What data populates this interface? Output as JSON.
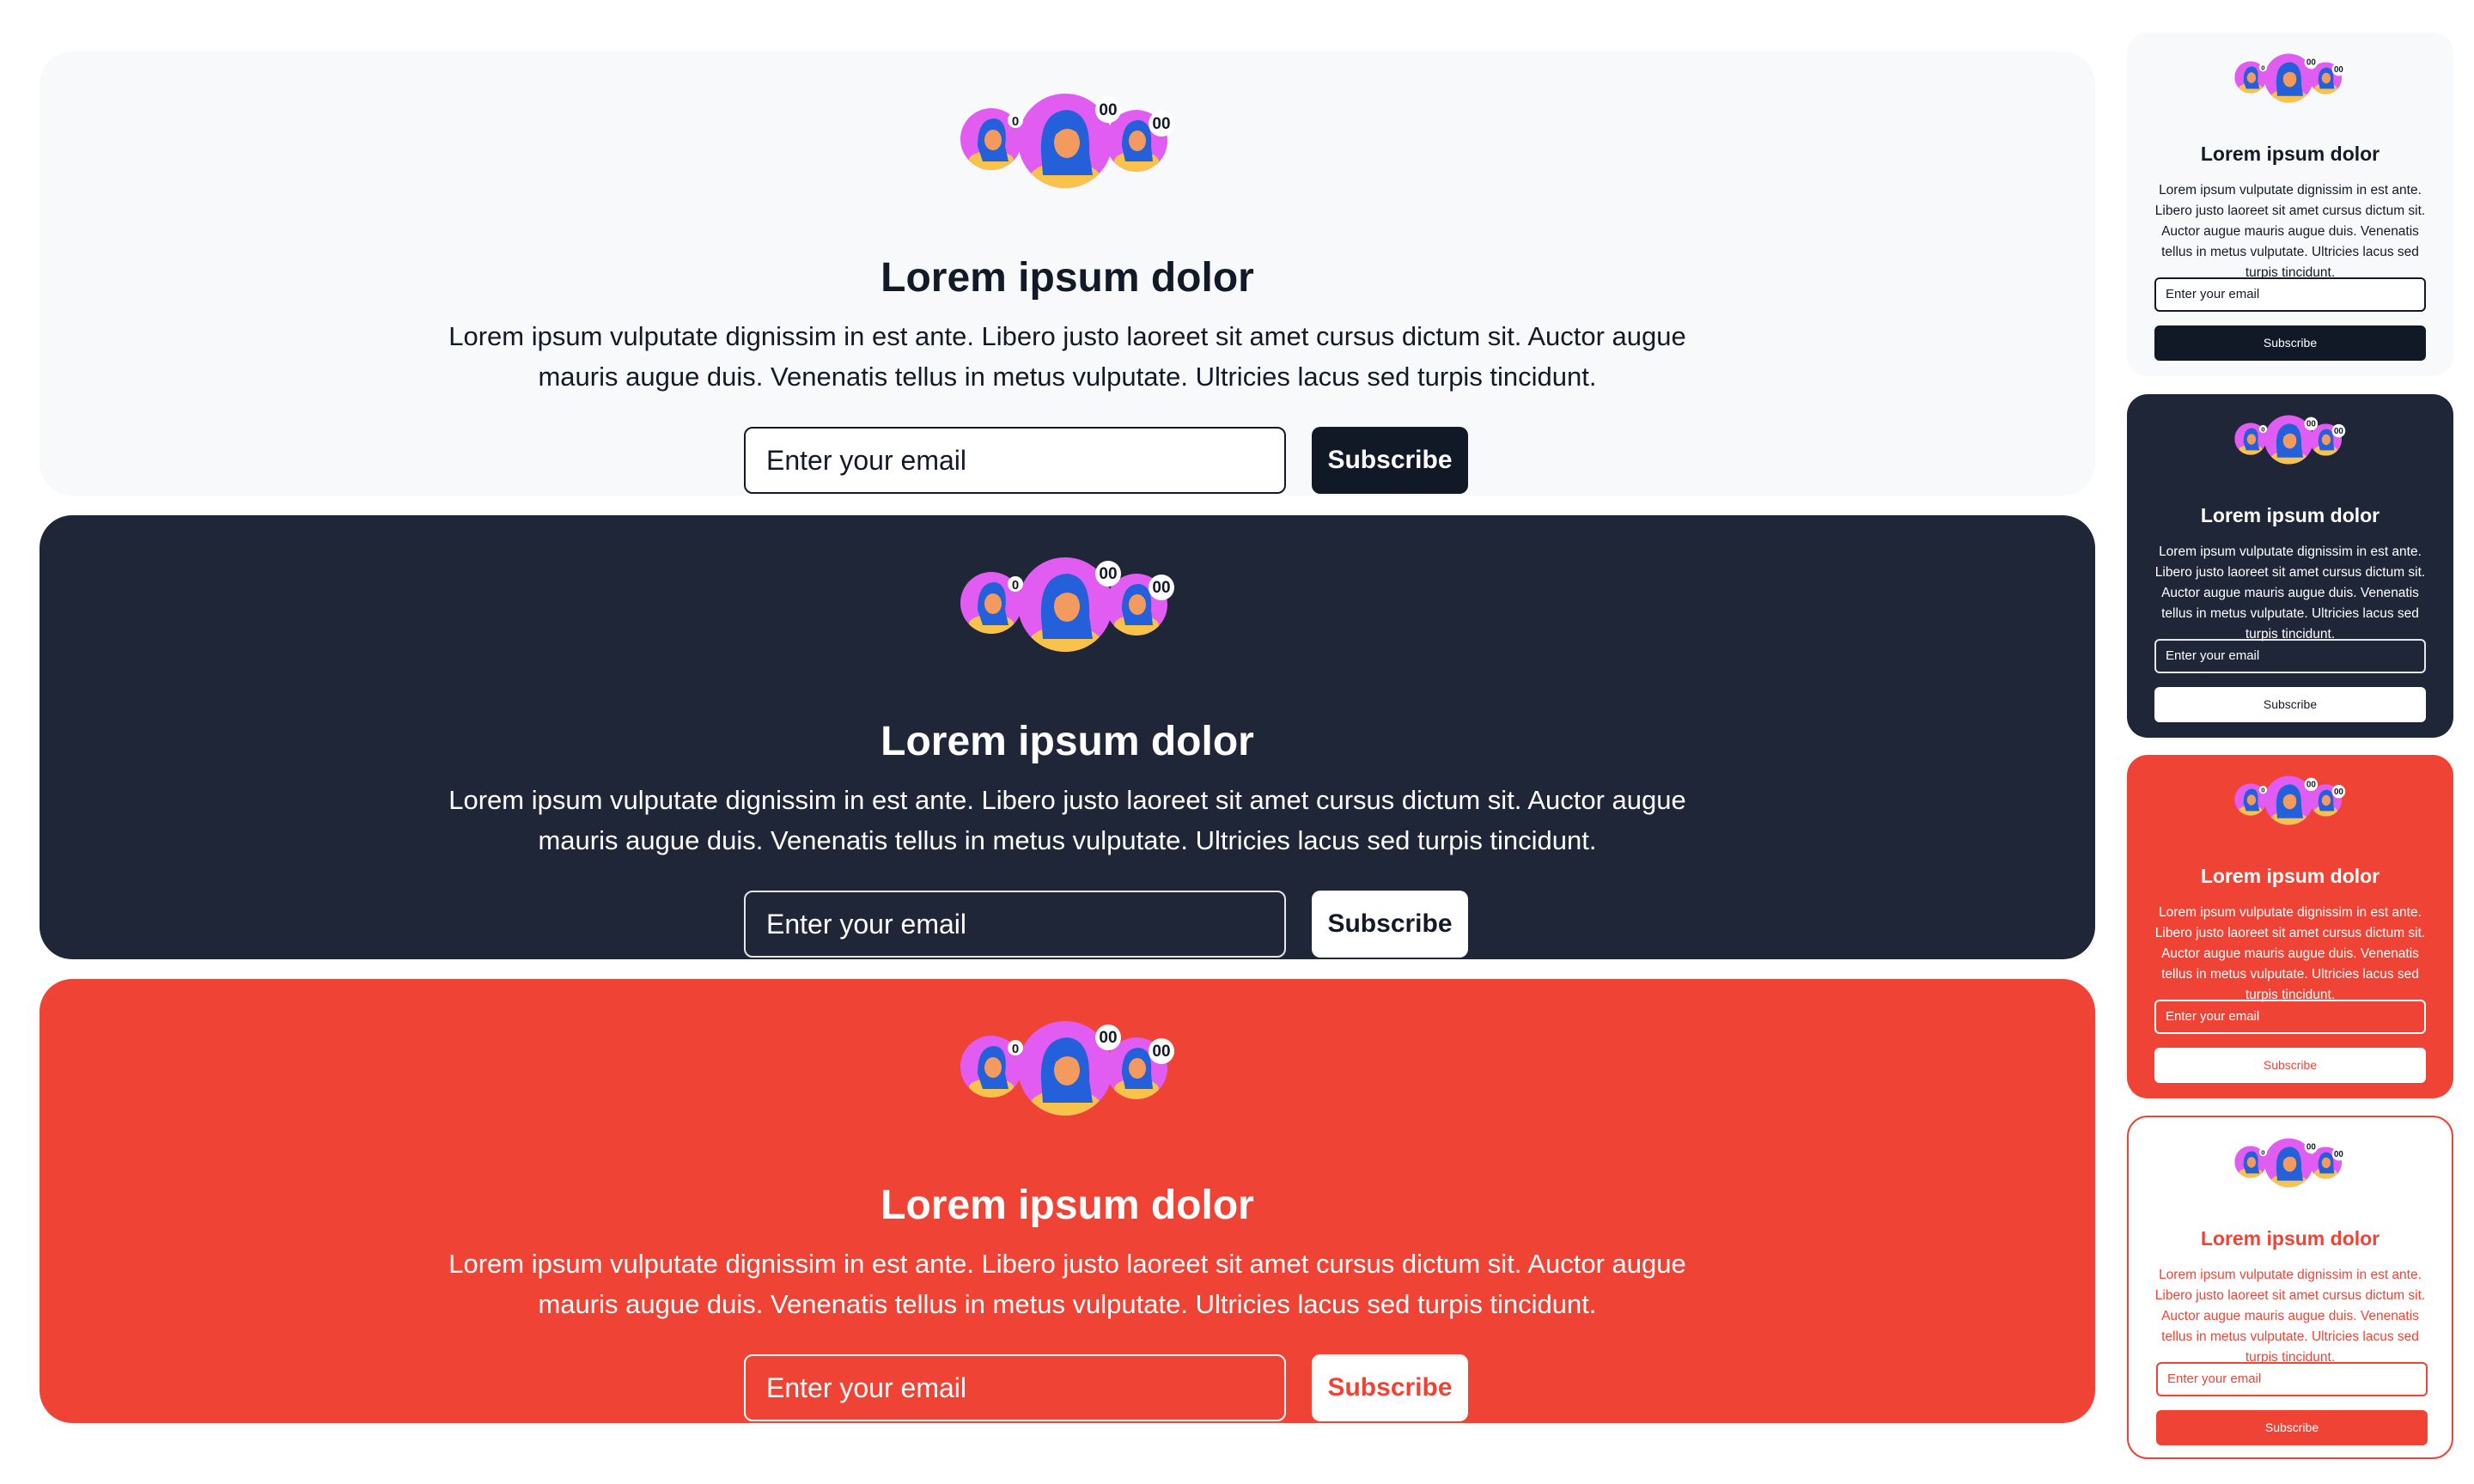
{
  "colors": {
    "light_bg": "#f8f9fb",
    "dark_bg": "#1f2637",
    "red": "#ef4336",
    "navy_button": "#111826",
    "avatar_pink": "#e15cf0",
    "avatar_yellow": "#f8c24b",
    "avatar_blue": "#2460d9"
  },
  "avatar_badge": "00",
  "cards": [
    {
      "theme": "light",
      "title": "Lorem ipsum dolor",
      "description": "Lorem ipsum vulputate dignissim in est ante. Libero justo laoreet sit amet cursus dictum sit. Auctor augue mauris augue duis. Venenatis tellus in metus vulputate. Ultricies lacus sed turpis tincidunt.",
      "email_placeholder": "Enter your email",
      "button": "Subscribe"
    },
    {
      "theme": "dark",
      "title": "Lorem ipsum dolor",
      "description": "Lorem ipsum vulputate dignissim in est ante. Libero justo laoreet sit amet cursus dictum sit. Auctor augue mauris augue duis. Venenatis tellus in metus vulputate. Ultricies lacus sed turpis tincidunt.",
      "email_placeholder": "Enter your email",
      "button": "Subscribe"
    },
    {
      "theme": "red",
      "title": "Lorem ipsum dolor",
      "description": "Lorem ipsum vulputate dignissim in est ante. Libero justo laoreet sit amet cursus dictum sit. Auctor augue mauris augue duis. Venenatis tellus in metus vulputate. Ultricies lacus sed turpis tincidunt.",
      "email_placeholder": "Enter your email",
      "button": "Subscribe"
    },
    {
      "theme": "light",
      "title": "Lorem ipsum dolor",
      "description": "Lorem ipsum vulputate dignissim in est ante. Libero justo laoreet sit amet cursus dictum sit. Auctor augue mauris augue duis. Venenatis tellus in metus vulputate. Ultricies lacus sed turpis tincidunt.",
      "email_placeholder": "Enter your email",
      "button": "Subscribe"
    },
    {
      "theme": "dark",
      "title": "Lorem ipsum dolor",
      "description": "Lorem ipsum vulputate dignissim in est ante. Libero justo laoreet sit amet cursus dictum sit. Auctor augue mauris augue duis. Venenatis tellus in metus vulputate. Ultricies lacus sed turpis tincidunt.",
      "email_placeholder": "Enter your email",
      "button": "Subscribe"
    },
    {
      "theme": "red",
      "title": "Lorem ipsum dolor",
      "description": "Lorem ipsum vulputate dignissim in est ante. Libero justo laoreet sit amet cursus dictum sit. Auctor augue mauris augue duis. Venenatis tellus in metus vulputate. Ultricies lacus sed turpis tincidunt.",
      "email_placeholder": "Enter your email",
      "button": "Subscribe"
    },
    {
      "theme": "white-outline",
      "title": "Lorem ipsum dolor",
      "description": "Lorem ipsum vulputate dignissim in est ante. Libero justo laoreet sit amet cursus dictum sit. Auctor augue mauris augue duis. Venenatis tellus in metus vulputate. Ultricies lacus sed turpis tincidunt.",
      "email_placeholder": "Enter your email",
      "button": "Subscribe"
    }
  ]
}
